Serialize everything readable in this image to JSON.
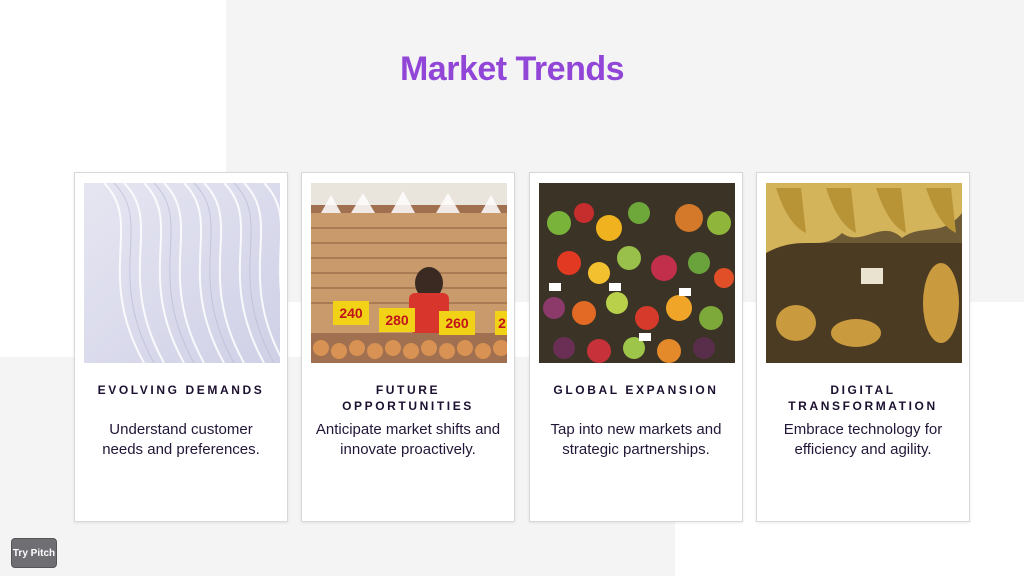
{
  "slide": {
    "title": "Market Trends"
  },
  "cards": [
    {
      "heading": "EVOLVING DEMANDS",
      "body": "Understand customer needs and preferences.",
      "image": "abstract-waves"
    },
    {
      "heading": "FUTURE OPPORTUNITIES",
      "body": "Anticipate market shifts and innovate proactively.",
      "image": "egg-market-vendor",
      "price_signs": [
        "240",
        "280",
        "260",
        "2"
      ]
    },
    {
      "heading": "GLOBAL EXPANSION",
      "body": "Tap into new markets and strategic partnerships.",
      "image": "produce-market-stall"
    },
    {
      "heading": "DIGITAL TRANSFORMATION",
      "body": "Embrace technology for efficiency and agility.",
      "image": "banana-market-stall"
    }
  ],
  "badge": {
    "label": "Try Pitch"
  },
  "colors": {
    "title": "#9146d8",
    "text": "#231638",
    "panel": "#f4f4f5"
  }
}
